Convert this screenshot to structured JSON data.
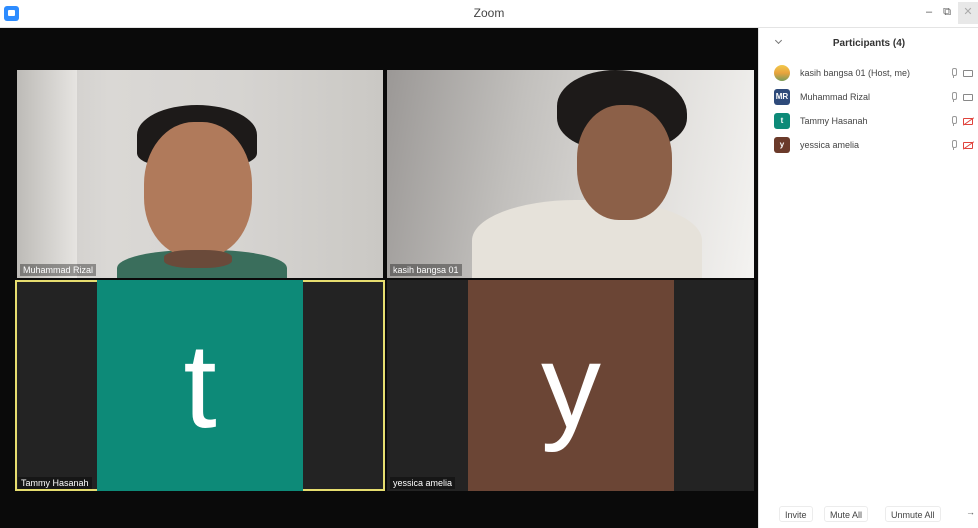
{
  "window": {
    "title": "Zoom",
    "minimize_glyph": "–",
    "maximize_glyph": "⧉",
    "close_glyph": "✕"
  },
  "gallery": {
    "tiles": [
      {
        "name": "Muhammad Rizal",
        "type": "video"
      },
      {
        "name": "kasih bangsa 01",
        "type": "video"
      },
      {
        "name": "Tammy Hasanah",
        "type": "avatar",
        "initial": "t",
        "color": "#0d8a78",
        "active_speaker": true
      },
      {
        "name": "yessica amelia",
        "type": "avatar",
        "initial": "y",
        "color": "#6b4535"
      }
    ]
  },
  "participants": {
    "title": "Participants (4)",
    "list": [
      {
        "name": "kasih bangsa 01 (Host, me)",
        "avatar": "photo",
        "camera": "on"
      },
      {
        "name": "Muhammad Rizal",
        "avatar_initials": "MR",
        "avatar_color": "#2e4a7a",
        "camera": "on"
      },
      {
        "name": "Tammy Hasanah",
        "avatar_initials": "t",
        "avatar_color": "#0d8a78",
        "camera": "off"
      },
      {
        "name": "yessica amelia",
        "avatar_initials": "y",
        "avatar_color": "#6b3a2a",
        "camera": "off"
      }
    ],
    "footer": {
      "invite_label": "Invite",
      "mute_all_label": "Mute All",
      "unmute_all_label": "Unmute All",
      "more_glyph": "→"
    }
  },
  "colors": {
    "active_speaker_border": "#e6dd6f",
    "camera_off": "#e0433c",
    "brand": "#2d8cff"
  }
}
